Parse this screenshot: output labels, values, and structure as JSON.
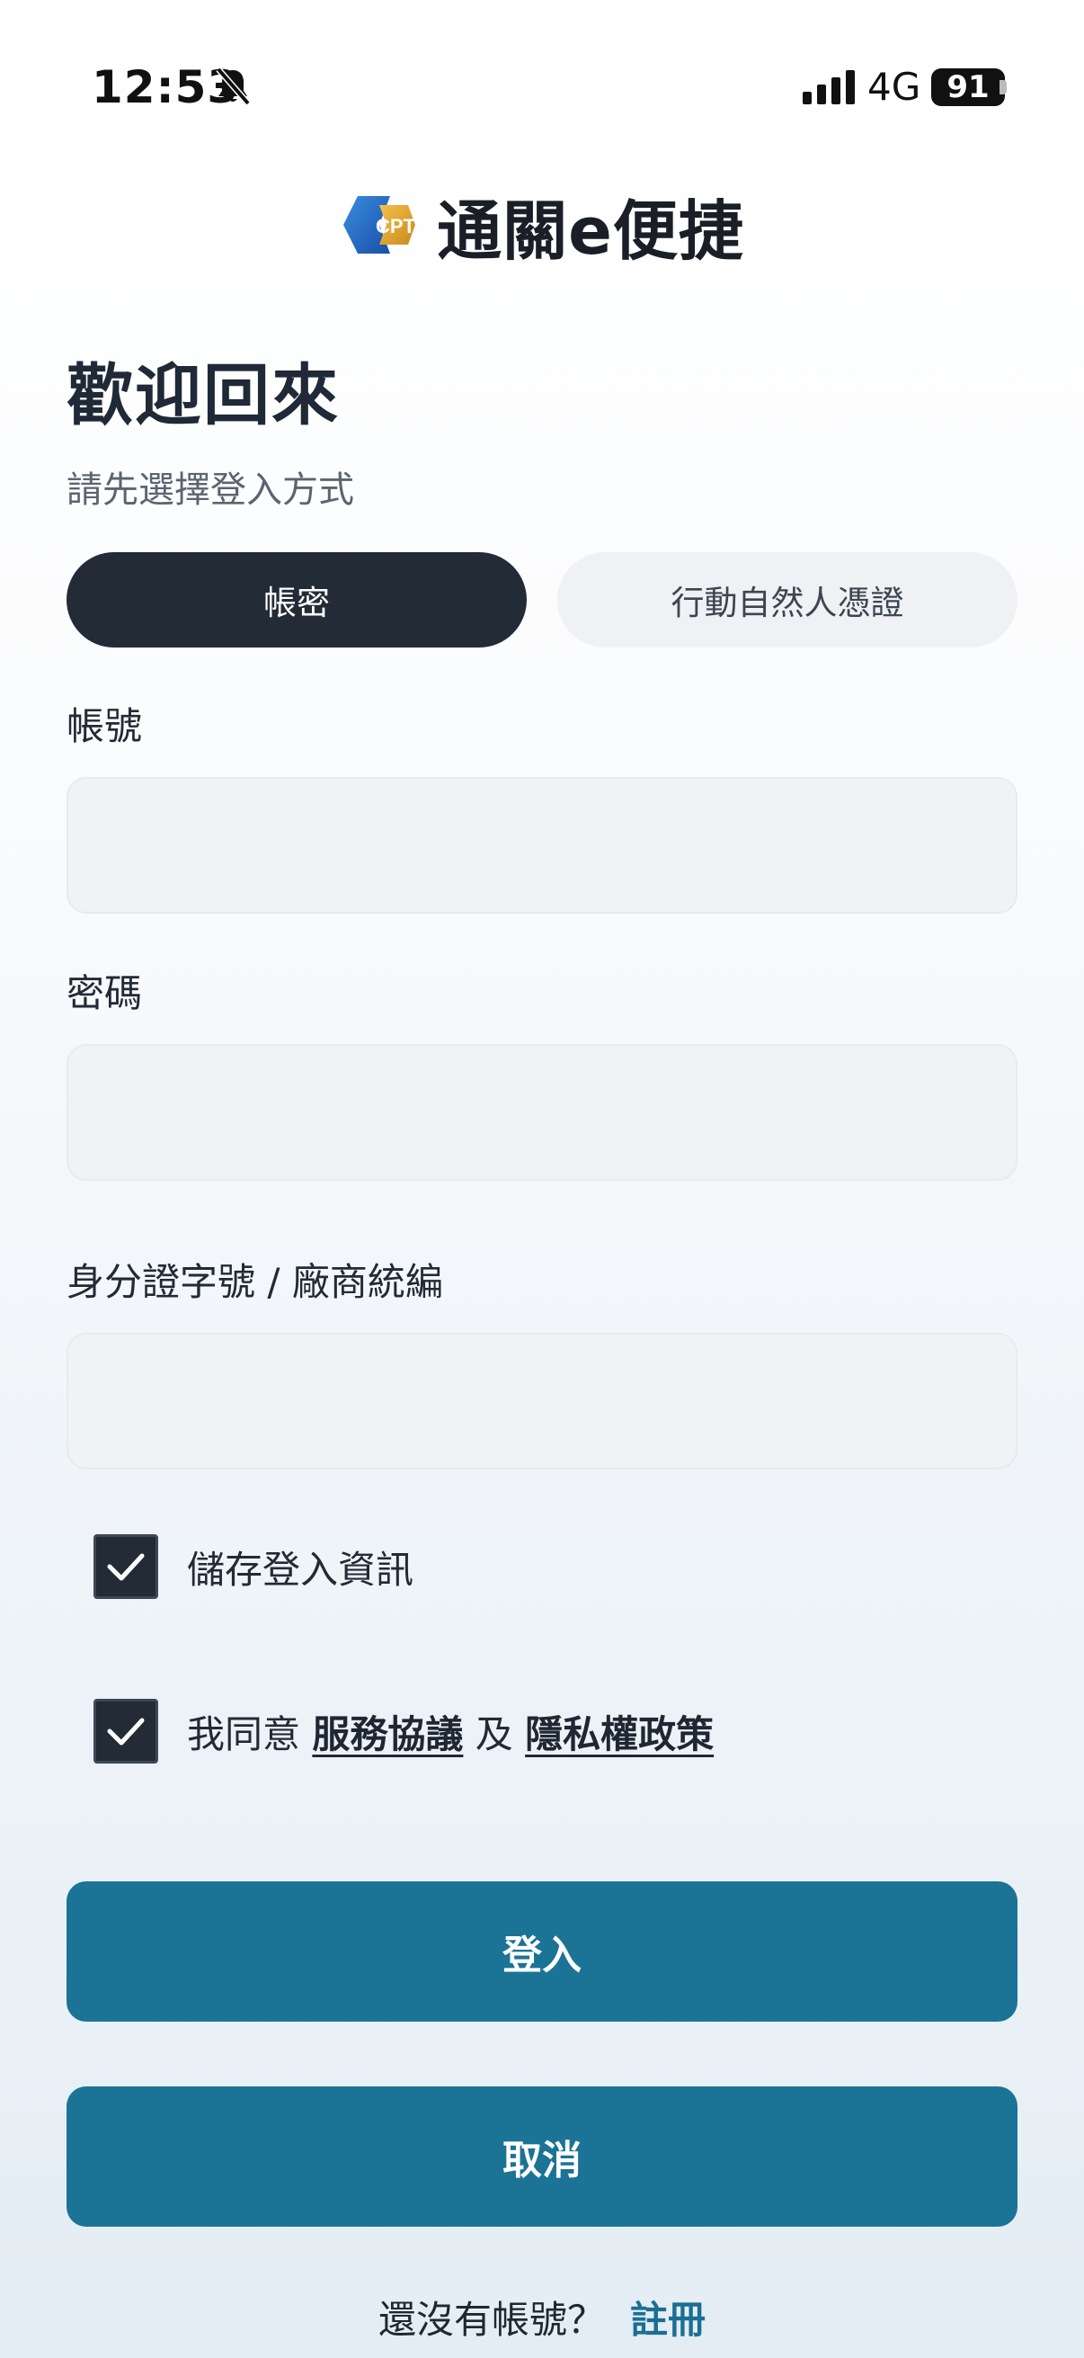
{
  "status_bar": {
    "time": "12:53",
    "network": "4G",
    "battery": "91"
  },
  "brand": {
    "logo_text": "CPT",
    "name": "通關e便捷"
  },
  "welcome": {
    "title": "歡迎回來",
    "subtitle": "請先選擇登入方式"
  },
  "tabs": [
    {
      "label": "帳密",
      "selected": true
    },
    {
      "label": "行動自然人憑證",
      "selected": false
    }
  ],
  "form": {
    "account_label": "帳號",
    "account_value": "",
    "password_label": "密碼",
    "password_value": "",
    "id_label": "身分證字號 / 廠商統編",
    "id_value": ""
  },
  "options": {
    "save_login_label": "儲存登入資訊",
    "save_login_checked": true,
    "agree_prefix": "我同意",
    "terms_link": "服務協議",
    "agree_and": "及",
    "privacy_link": "隱私權政策",
    "agree_checked": true
  },
  "buttons": {
    "login": "登入",
    "cancel": "取消"
  },
  "register": {
    "prompt": "還沒有帳號？",
    "link": "註冊"
  },
  "colors": {
    "primary": "#1b7396",
    "dark": "#222b36",
    "link": "#1b6f92"
  }
}
